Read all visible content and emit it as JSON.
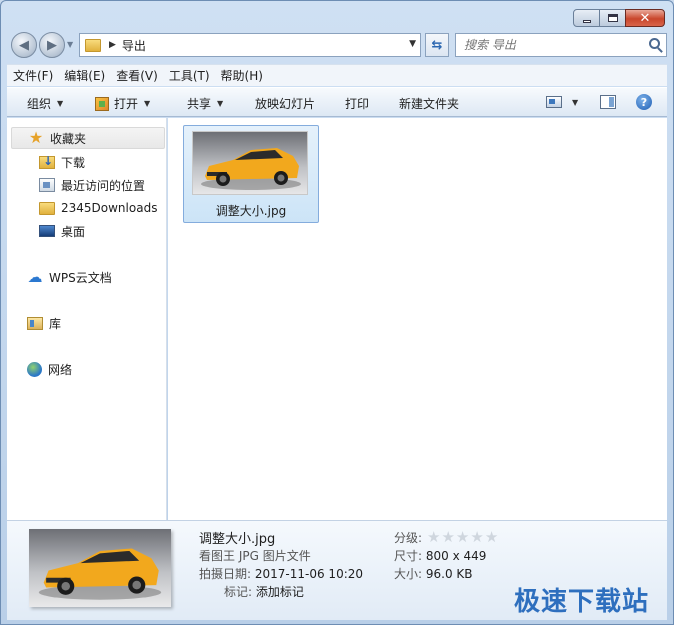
{
  "window": {
    "close_glyph": "✕"
  },
  "address": {
    "path_segment": "导出"
  },
  "search": {
    "placeholder": "搜索 导出"
  },
  "menu": [
    "文件(F)",
    "编辑(E)",
    "查看(V)",
    "工具(T)",
    "帮助(H)"
  ],
  "commands": {
    "organize": "组织",
    "open": "打开",
    "share": "共享",
    "slideshow": "放映幻灯片",
    "print": "打印",
    "new_folder": "新建文件夹",
    "help_glyph": "?"
  },
  "nav": {
    "favorites": "收藏夹",
    "downloads": "下载",
    "recent": "最近访问的位置",
    "downloads2345": "2345Downloads",
    "desktop": "桌面",
    "wps": "WPS云文档",
    "libraries": "库",
    "network": "网络"
  },
  "files": [
    {
      "name": "调整大小.jpg"
    }
  ],
  "details": {
    "filename": "调整大小.jpg",
    "type": "看图王 JPG 图片文件",
    "date_label": "拍摄日期:",
    "date_value": "2017-11-06 10:20",
    "tags_label": "标记:",
    "tags_value": "添加标记",
    "rating_label": "分级:",
    "rating_value": 0,
    "dims_label": "尺寸:",
    "dims_value": "800 x 449",
    "size_label": "大小:",
    "size_value": "96.0 KB"
  },
  "watermark": "极速下载站",
  "colors": {
    "accent": "#2e6fbe",
    "car": "#f2a81d",
    "selection": "#cce4f7"
  }
}
